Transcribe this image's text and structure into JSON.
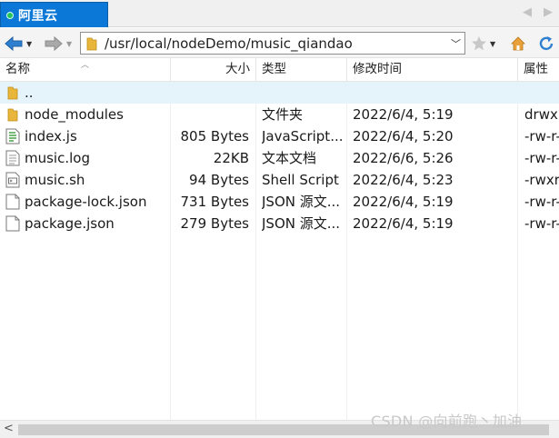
{
  "tab": {
    "label": "阿里云"
  },
  "address": {
    "path": "/usr/local/nodeDemo/music_qiandao"
  },
  "columns": [
    "名称",
    "大小",
    "类型",
    "修改时间",
    "属性"
  ],
  "files": [
    {
      "name": "..",
      "size": "",
      "type": "",
      "modified": "",
      "attr": "",
      "icon": "folder-icon"
    },
    {
      "name": "node_modules",
      "size": "",
      "type": "文件夹",
      "modified": "2022/6/4, 5:19",
      "attr": "drwxr",
      "icon": "folder-icon"
    },
    {
      "name": "index.js",
      "size": "805 Bytes",
      "type": "JavaScript...",
      "modified": "2022/6/4, 5:20",
      "attr": "-rw-r-",
      "icon": "js-file-icon"
    },
    {
      "name": "music.log",
      "size": "22KB",
      "type": "文本文档",
      "modified": "2022/6/6, 5:26",
      "attr": "-rw-r-",
      "icon": "text-file-icon"
    },
    {
      "name": "music.sh",
      "size": "94 Bytes",
      "type": "Shell Script",
      "modified": "2022/6/4, 5:23",
      "attr": "-rwxr",
      "icon": "shell-file-icon"
    },
    {
      "name": "package-lock.json",
      "size": "731 Bytes",
      "type": "JSON 源文...",
      "modified": "2022/6/4, 5:19",
      "attr": "-rw-r-",
      "icon": "file-icon"
    },
    {
      "name": "package.json",
      "size": "279 Bytes",
      "type": "JSON 源文...",
      "modified": "2022/6/4, 5:19",
      "attr": "-rw-r-",
      "icon": "file-icon"
    }
  ],
  "watermark": "CSDN @向前跑丶加油",
  "colors": {
    "tab_active": "#0b78d7",
    "selected_row": "#e5f3fb",
    "folder": "#e8b63a"
  }
}
